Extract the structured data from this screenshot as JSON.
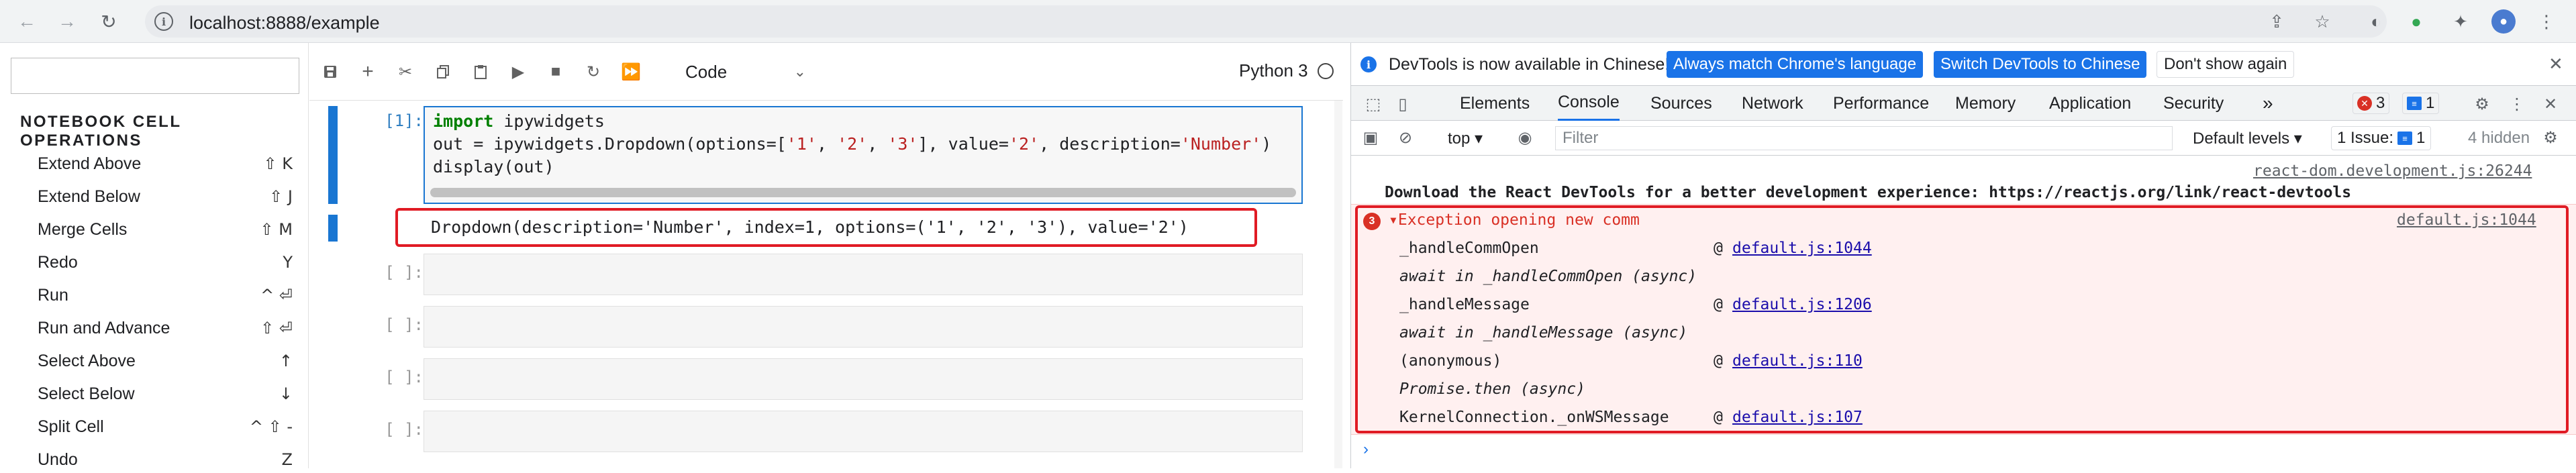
{
  "browser": {
    "url": "localhost:8888/example"
  },
  "command_palette": {
    "search_value": "",
    "section_title": "NOTEBOOK CELL OPERATIONS",
    "items": [
      {
        "label": "Extend Above",
        "shortcut": "⇧ K"
      },
      {
        "label": "Extend Below",
        "shortcut": "⇧ J"
      },
      {
        "label": "Merge Cells",
        "shortcut": "⇧ M"
      },
      {
        "label": "Redo",
        "shortcut": "Y"
      },
      {
        "label": "Run",
        "shortcut": "^ ⏎"
      },
      {
        "label": "Run and Advance",
        "shortcut": "⇧ ⏎"
      },
      {
        "label": "Select Above",
        "shortcut": "↑"
      },
      {
        "label": "Select Below",
        "shortcut": "↓"
      },
      {
        "label": "Split Cell",
        "shortcut": "^ ⇧ -"
      },
      {
        "label": "Undo",
        "shortcut": "Z"
      }
    ]
  },
  "notebook": {
    "cell_type": "Code",
    "kernel": "Python 3",
    "active_prompt": "[1]:",
    "empty_prompt": "[ ]:",
    "code": {
      "line1_kw": "import",
      "line1_rest": " ipywidgets",
      "line2_a": "out = ipywidgets.Dropdown(options=[",
      "line2_s1": "'1'",
      "line2_c1": ", ",
      "line2_s2": "'2'",
      "line2_c2": ", ",
      "line2_s3": "'3'",
      "line2_b": "], value=",
      "line2_s4": "'2'",
      "line2_c": ", description=",
      "line2_s5": "'Number'",
      "line2_d": ")",
      "line3": "display(out)"
    },
    "output": "Dropdown(description='Number', index=1, options=('1', '2', '3'), value='2')"
  },
  "devtools": {
    "info_text": "DevTools is now available in Chinese!",
    "btn_match": "Always match Chrome's language",
    "btn_switch": "Switch DevTools to Chinese",
    "btn_dismiss": "Don't show again",
    "tabs": [
      "Elements",
      "Console",
      "Sources",
      "Network",
      "Performance",
      "Memory",
      "Application",
      "Security"
    ],
    "more_tabs": "»",
    "error_count": "3",
    "message_count": "1",
    "context": "top ▾",
    "filter_placeholder": "Filter",
    "levels": "Default levels ▾",
    "issues_label": "1 Issue:",
    "issues_count": "1",
    "hidden": "4 hidden",
    "console": {
      "react_source": "react-dom.development.js:26244",
      "react_msg": "Download the React DevTools for a better development experience: https://reactjs.org/link/react-devtools",
      "error_badge": "3",
      "error_title": "▾Exception opening new comm",
      "error_source": "default.js:1044",
      "stack": [
        {
          "fn": "_handleCommOpen",
          "at": "@",
          "link": "default.js:1044",
          "async": false
        },
        {
          "fn": "await in _handleCommOpen (async)",
          "at": "",
          "link": "",
          "async": true
        },
        {
          "fn": "_handleMessage",
          "at": "@",
          "link": "default.js:1206",
          "async": false
        },
        {
          "fn": "await in _handleMessage (async)",
          "at": "",
          "link": "",
          "async": true
        },
        {
          "fn": "(anonymous)",
          "at": "@",
          "link": "default.js:110",
          "async": false
        },
        {
          "fn": "Promise.then (async)",
          "at": "",
          "link": "",
          "async": true
        },
        {
          "fn": "KernelConnection._onWSMessage",
          "at": "@",
          "link": "default.js:107",
          "async": false
        }
      ],
      "prompt": "›"
    }
  }
}
